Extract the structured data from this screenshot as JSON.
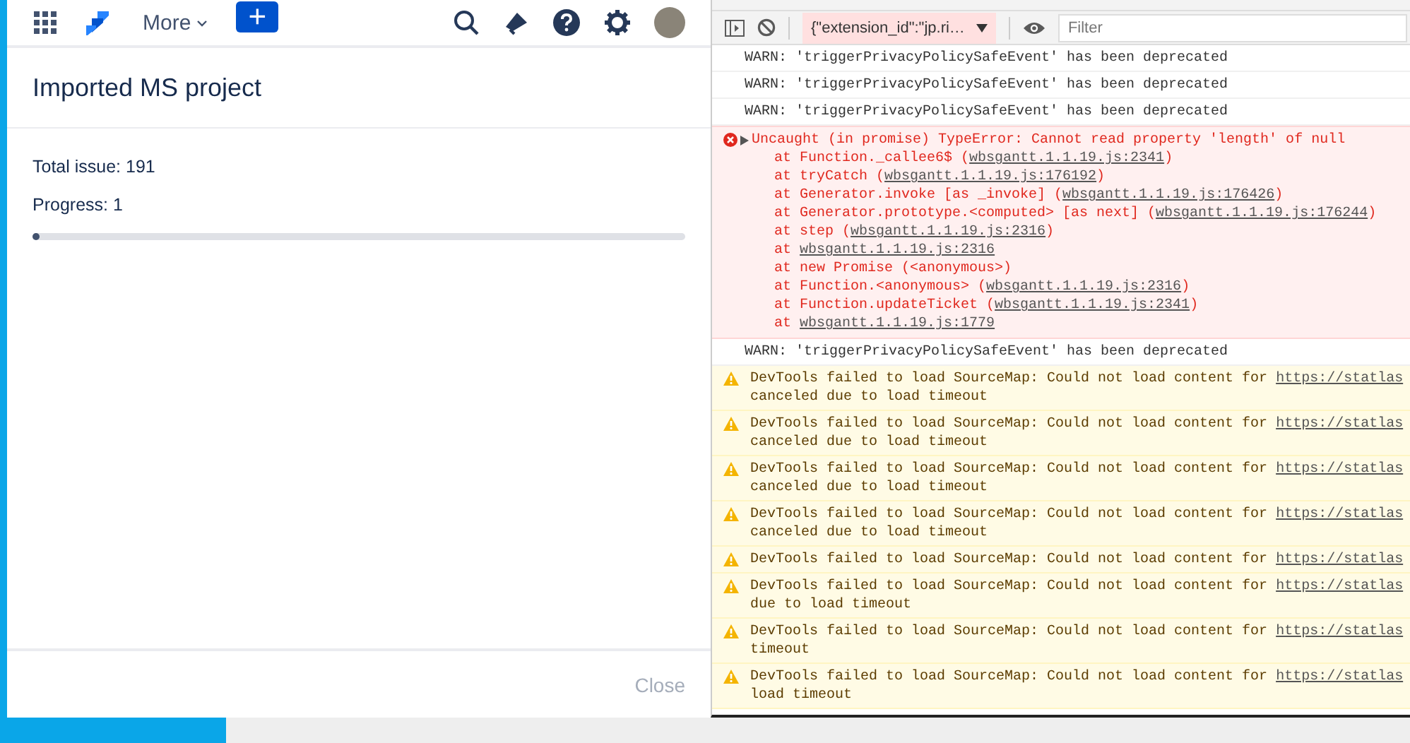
{
  "nav": {
    "more_label": "More",
    "create_label": "+"
  },
  "dialog": {
    "title": "Imported MS project",
    "total": "Total issue: 191",
    "progress_label": "Progress: 1",
    "progress": {
      "level": 0.01
    },
    "close_button": {
      "label": "Close",
      "disabled": true
    }
  },
  "devtools": {
    "context": "{\"extension_id\":\"jp.ri…",
    "filter_placeholder": "Filter",
    "messages": [
      {
        "kind": "log",
        "text": "WARN: 'triggerPrivacyPolicySafeEvent' has been deprecated"
      },
      {
        "kind": "log",
        "text": "WARN: 'triggerPrivacyPolicySafeEvent' has been deprecated"
      },
      {
        "kind": "log",
        "text": "WARN: 'triggerPrivacyPolicySafeEvent' has been deprecated"
      },
      {
        "kind": "error",
        "text": "Uncaught (in promise) TypeError: Cannot read property 'length' of null",
        "expanded": false,
        "stack": [
          {
            "text": "at Function._callee6$ (",
            "link": "wbsgantt.1.1.19.js:2341",
            "suffix": ")"
          },
          {
            "text": "at tryCatch (",
            "link": "wbsgantt.1.1.19.js:176192",
            "suffix": ")"
          },
          {
            "text": "at Generator.invoke [as _invoke] (",
            "link": "wbsgantt.1.1.19.js:176426",
            "suffix": ")"
          },
          {
            "text": "at Generator.prototype.<computed> [as next] (",
            "link": "wbsgantt.1.1.19.js:176244",
            "suffix": ")"
          },
          {
            "text": "at step (",
            "link": "wbsgantt.1.1.19.js:2316",
            "suffix": ")"
          },
          {
            "text": "at ",
            "link": "wbsgantt.1.1.19.js:2316"
          },
          {
            "text": "at new Promise (<anonymous>)"
          },
          {
            "text": "at Function.<anonymous> (",
            "link": "wbsgantt.1.1.19.js:2316",
            "suffix": ")"
          },
          {
            "text": "at Function.updateTicket (",
            "link": "wbsgantt.1.1.19.js:2341",
            "suffix": ")"
          },
          {
            "text": "at ",
            "link": "wbsgantt.1.1.19.js:1779"
          }
        ]
      },
      {
        "kind": "log",
        "text": "WARN: 'triggerPrivacyPolicySafeEvent' has been deprecated"
      },
      {
        "kind": "warning",
        "text": "DevTools failed to load SourceMap: Could not load content for ",
        "link": "https://statlas",
        "continuation": "canceled due to load timeout"
      },
      {
        "kind": "warning",
        "text": "DevTools failed to load SourceMap: Could not load content for ",
        "link": "https://statlas",
        "continuation": "canceled due to load timeout"
      },
      {
        "kind": "warning",
        "text": "DevTools failed to load SourceMap: Could not load content for ",
        "link": "https://statlas",
        "continuation": "canceled due to load timeout"
      },
      {
        "kind": "warning",
        "text": "DevTools failed to load SourceMap: Could not load content for ",
        "link": "https://statlas",
        "continuation": "canceled due to load timeout"
      },
      {
        "kind": "warning",
        "text": "DevTools failed to load SourceMap: Could not load content for ",
        "link": "https://statlas"
      },
      {
        "kind": "warning",
        "text": "DevTools failed to load SourceMap: Could not load content for ",
        "link": "https://statlas",
        "continuation": "due to load timeout"
      },
      {
        "kind": "warning",
        "text": "DevTools failed to load SourceMap: Could not load content for ",
        "link": "https://statlas",
        "continuation": "timeout"
      },
      {
        "kind": "warning",
        "text": "DevTools failed to load SourceMap: Could not load content for ",
        "link": "https://statlas",
        "continuation": "load timeout"
      }
    ]
  }
}
